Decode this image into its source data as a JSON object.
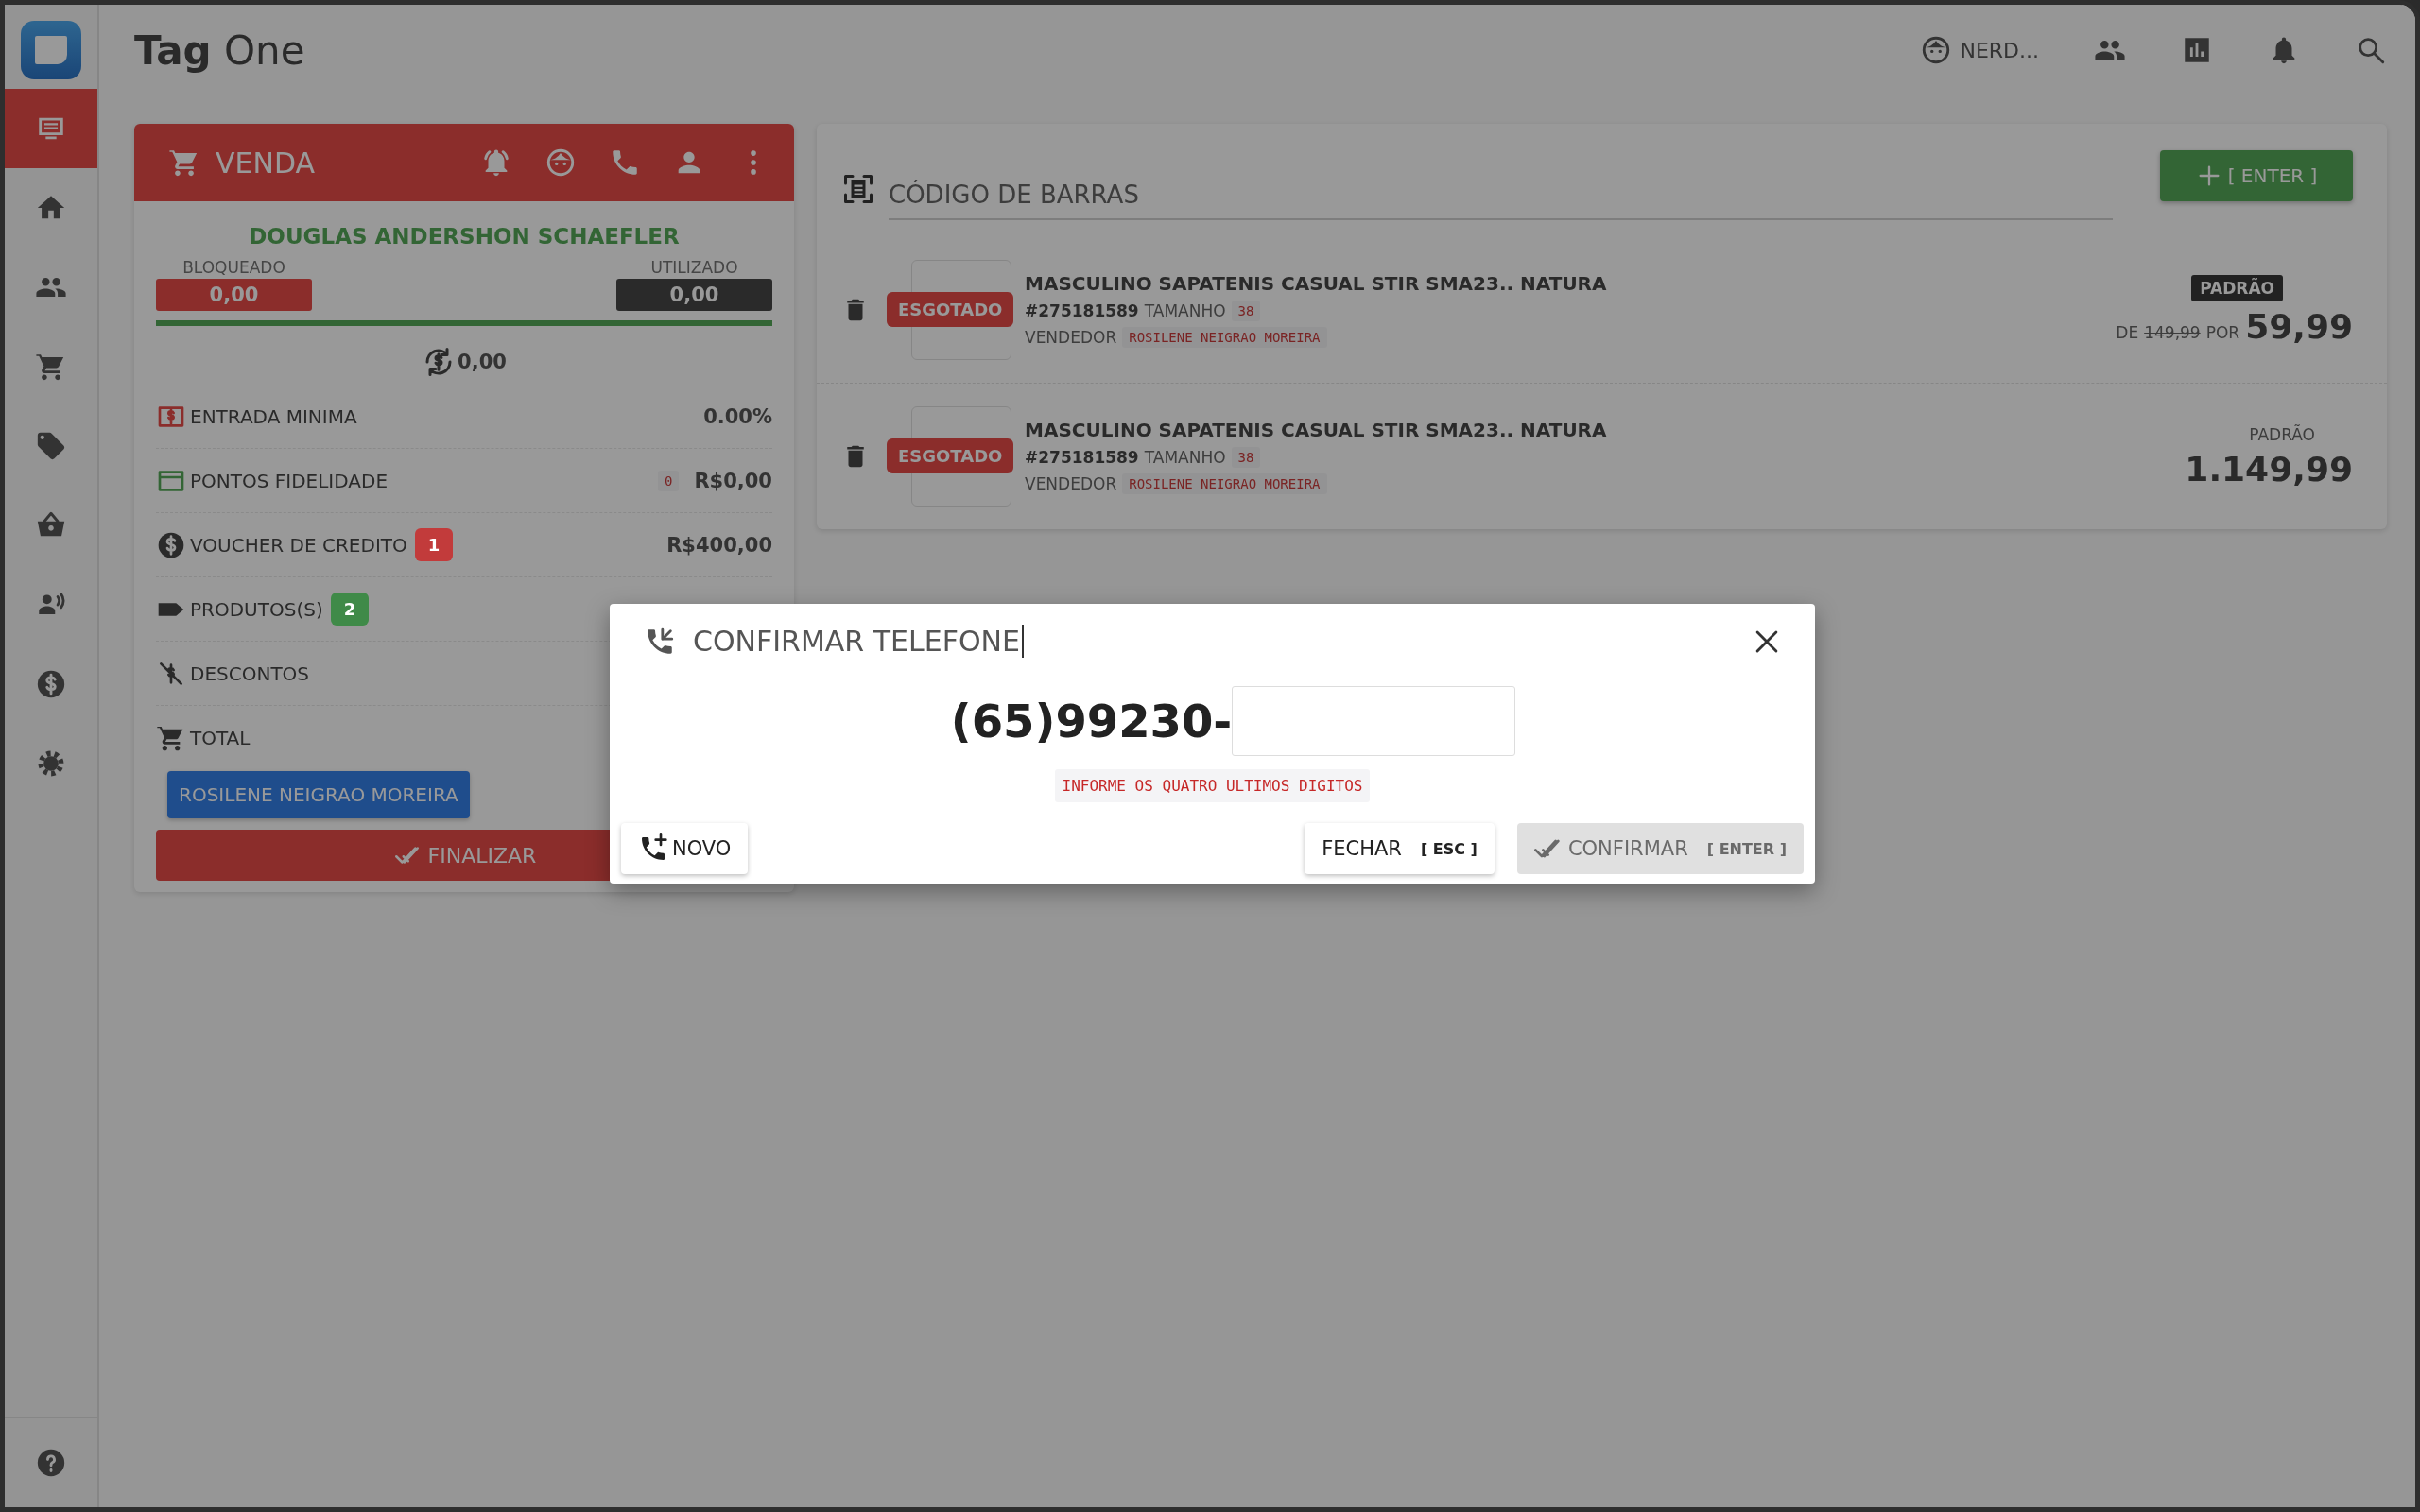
{
  "app": {
    "title": "**Tag** One"
  },
  "header": {
    "user": "NERD...",
    "icons": [
      {
        "kind": "people"
      },
      {
        "kind": "chart"
      },
      {
        "kind": "bell"
      },
      {
        "kind": "search"
      }
    ]
  },
  "sidebar": {
    "items": [
      {
        "kind": "sale",
        "selected": true
      },
      {
        "kind": "home",
        "selected": false
      },
      {
        "kind": "people",
        "selected": false
      },
      {
        "kind": "cart",
        "selected": false
      },
      {
        "kind": "tag",
        "selected": false
      },
      {
        "kind": "basket",
        "selected": false
      },
      {
        "kind": "speaker",
        "selected": false
      },
      {
        "kind": "money",
        "selected": false
      },
      {
        "kind": "gear",
        "selected": false
      }
    ],
    "help": {
      "kind": "help"
    }
  },
  "sale": {
    "title": "VENDA",
    "customer": "DOUGLAS ANDERSHON SCHAEFLER",
    "blocked_label": "BLOQUEADO",
    "blocked_value": "0,00",
    "used_label": "UTILIZADO",
    "used_value": "0,00",
    "cashback": "0,00",
    "rows": [
      {
        "kind": "entry",
        "label": "ENTRADA MINIMA",
        "value": "0.00%"
      },
      {
        "kind": "points",
        "label": "PONTOS FIDELIDADE",
        "code": "0",
        "value": "R$0,00"
      },
      {
        "kind": "voucher",
        "label": "VOUCHER DE CREDITO",
        "count": "1",
        "color": "#c23b3b",
        "value": "R$400,00"
      },
      {
        "kind": "products",
        "label": "PRODUTOS(S)",
        "count": "2",
        "color": "#3f8a48"
      },
      {
        "kind": "discounts",
        "label": "DESCONTOS"
      },
      {
        "kind": "total",
        "label": "TOTAL"
      }
    ],
    "seller_button": "ROSILENE NEIGRAO MOREIRA",
    "finish_button": "FINALIZAR"
  },
  "barcode": {
    "title": "CÓDIGO DE BARRAS",
    "add_button": "[ ENTER ]",
    "items": [
      {
        "status": "ESGOTADO",
        "name": "MASCULINO SAPATENIS CASUAL STIR SMA23.. NATURA",
        "code": "#275181589",
        "size_label": "TAMANHO",
        "size": "38",
        "seller_label": "VENDEDOR",
        "seller": "ROSILENE NEIGRAO MOREIRA",
        "price_tag": "PADRÃO",
        "tag_boxed": true,
        "from_label": "DE",
        "old_price": "149,99",
        "by_label": "POR",
        "price": "59,99"
      },
      {
        "status": "ESGOTADO",
        "name": "MASCULINO SAPATENIS CASUAL STIR SMA23.. NATURA",
        "code": "#275181589",
        "size_label": "TAMANHO",
        "size": "38",
        "seller_label": "VENDEDOR",
        "seller": "ROSILENE NEIGRAO MOREIRA",
        "price_tag": "PADRÃO",
        "tag_boxed": false,
        "price": "1.149,99"
      }
    ]
  },
  "dialog": {
    "title": "CONFIRMAR TELEFONE",
    "phone_prefix": "(65)99230-",
    "hint": "INFORME OS QUATRO ULTIMOS DIGITOS",
    "new_button": "NOVO",
    "close_button": "FECHAR",
    "close_key": "[ ESC ]",
    "confirm_button": "CONFIRMAR",
    "confirm_key": "[ ENTER ]",
    "confirm_disabled": true
  }
}
